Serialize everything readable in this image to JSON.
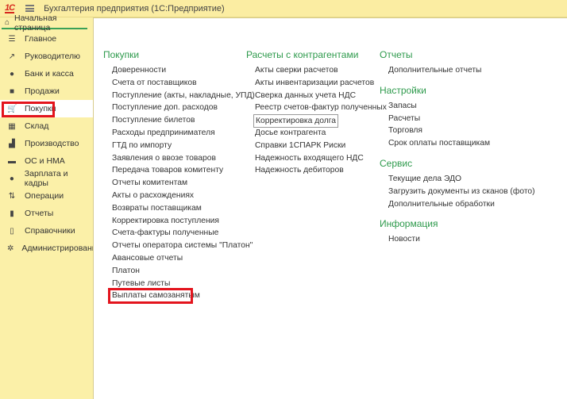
{
  "app": {
    "logo": "1С",
    "title": "Бухгалтерия предприятия  (1С:Предприятие)",
    "home_tab": "Начальная страница"
  },
  "sidebar": {
    "items": [
      {
        "label": "Главное",
        "icon": "menu-icon"
      },
      {
        "label": "Руководителю",
        "icon": "trend-icon"
      },
      {
        "label": "Банк и касса",
        "icon": "coin-icon"
      },
      {
        "label": "Продажи",
        "icon": "bag-icon"
      },
      {
        "label": "Покупки",
        "icon": "cart-icon"
      },
      {
        "label": "Склад",
        "icon": "grid-icon"
      },
      {
        "label": "Производство",
        "icon": "factory-icon"
      },
      {
        "label": "ОС и НМА",
        "icon": "truck-icon"
      },
      {
        "label": "Зарплата и кадры",
        "icon": "person-icon"
      },
      {
        "label": "Операции",
        "icon": "operations-icon"
      },
      {
        "label": "Отчеты",
        "icon": "bar-chart-icon"
      },
      {
        "label": "Справочники",
        "icon": "books-icon"
      },
      {
        "label": "Администрирование",
        "icon": "gear-icon"
      }
    ]
  },
  "purchases": {
    "title": "Покупки",
    "items": [
      "Доверенности",
      "Счета от поставщиков",
      "Поступление (акты, накладные, УПД)",
      "Поступление доп. расходов",
      "Поступление билетов",
      "Расходы предпринимателя",
      "ГТД по импорту",
      "Заявления о ввозе товаров",
      "Передача товаров комитенту",
      "Отчеты комитентам",
      "Акты о расхождениях",
      "Возвраты поставщикам",
      "Корректировка поступления",
      "Счета-фактуры полученные",
      "Отчеты оператора системы \"Платон\"",
      "Авансовые отчеты",
      "Платон",
      "Путевые листы",
      "Выплаты самозанятым"
    ]
  },
  "settlements": {
    "title": "Расчеты с контрагентами",
    "items": [
      "Акты сверки расчетов",
      "Акты инвентаризации расчетов",
      "Сверка данных учета НДС",
      "Реестр счетов-фактур полученных",
      "Корректировка долга",
      "Досье контрагента",
      "Справки 1СПАРК Риски",
      "Надежность входящего НДС",
      "Надежность дебиторов"
    ]
  },
  "reports": {
    "title": "Отчеты",
    "items": [
      "Дополнительные отчеты"
    ]
  },
  "settings": {
    "title": "Настройки",
    "items": [
      "Запасы",
      "Расчеты",
      "Торговля",
      "Срок оплаты поставщикам"
    ]
  },
  "service": {
    "title": "Сервис",
    "items": [
      "Текущие дела ЭДО",
      "Загрузить документы из сканов (фото)",
      "Дополнительные обработки"
    ]
  },
  "info": {
    "title": "Информация",
    "items": [
      "Новости"
    ]
  }
}
